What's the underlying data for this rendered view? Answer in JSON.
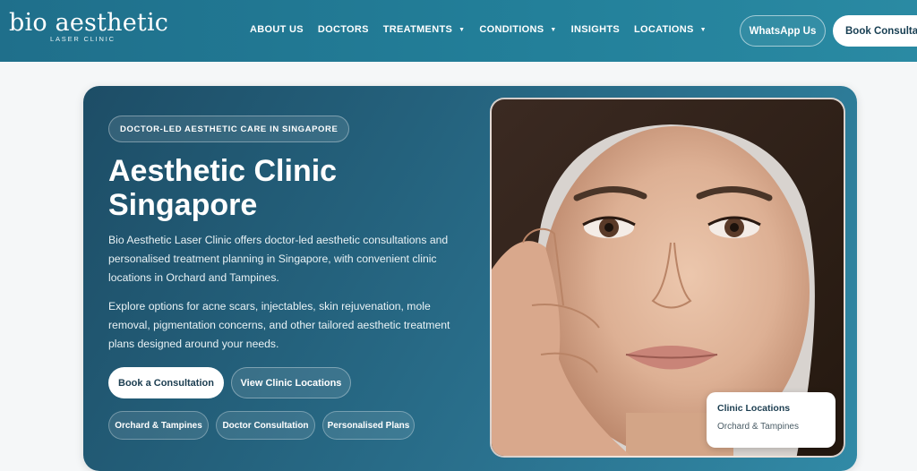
{
  "header": {
    "logo_main": "bio aesthetic",
    "logo_sub": "LASER CLINIC",
    "nav": [
      {
        "label": "ABOUT US",
        "dropdown": false
      },
      {
        "label": "DOCTORS",
        "dropdown": false
      },
      {
        "label": "TREATMENTS",
        "dropdown": true
      },
      {
        "label": "CONDITIONS",
        "dropdown": true
      },
      {
        "label": "INSIGHTS",
        "dropdown": false
      },
      {
        "label": "LOCATIONS",
        "dropdown": true
      }
    ],
    "caret": "▼",
    "whatsapp_label": "WhatsApp Us",
    "book_label": "Book Consultation"
  },
  "hero": {
    "badge": "DOCTOR-LED AESTHETIC CARE IN SINGAPORE",
    "title": "Aesthetic Clinic Singapore",
    "paragraph1": "Bio Aesthetic Laser Clinic offers doctor-led aesthetic consultations and personalised treatment planning in Singapore, with convenient clinic locations in Orchard and Tampines.",
    "paragraph2": "Explore options for acne scars, injectables, skin rejuvenation, mole removal, pigmentation concerns, and other tailored aesthetic treatment plans designed around your needs.",
    "primary_button": "Book a Consultation",
    "secondary_button": "View Clinic Locations",
    "chips": [
      "Orchard & Tampines",
      "Doctor Consultation",
      "Personalised Plans"
    ]
  },
  "location_card": {
    "title": "Clinic Locations",
    "subtitle": "Orchard & Tampines"
  },
  "colors": {
    "header_bg": "#23809a",
    "hero_bg_dark": "#1d4d66",
    "hero_bg_light": "#318aa6",
    "text_dark": "#1b3d50"
  }
}
